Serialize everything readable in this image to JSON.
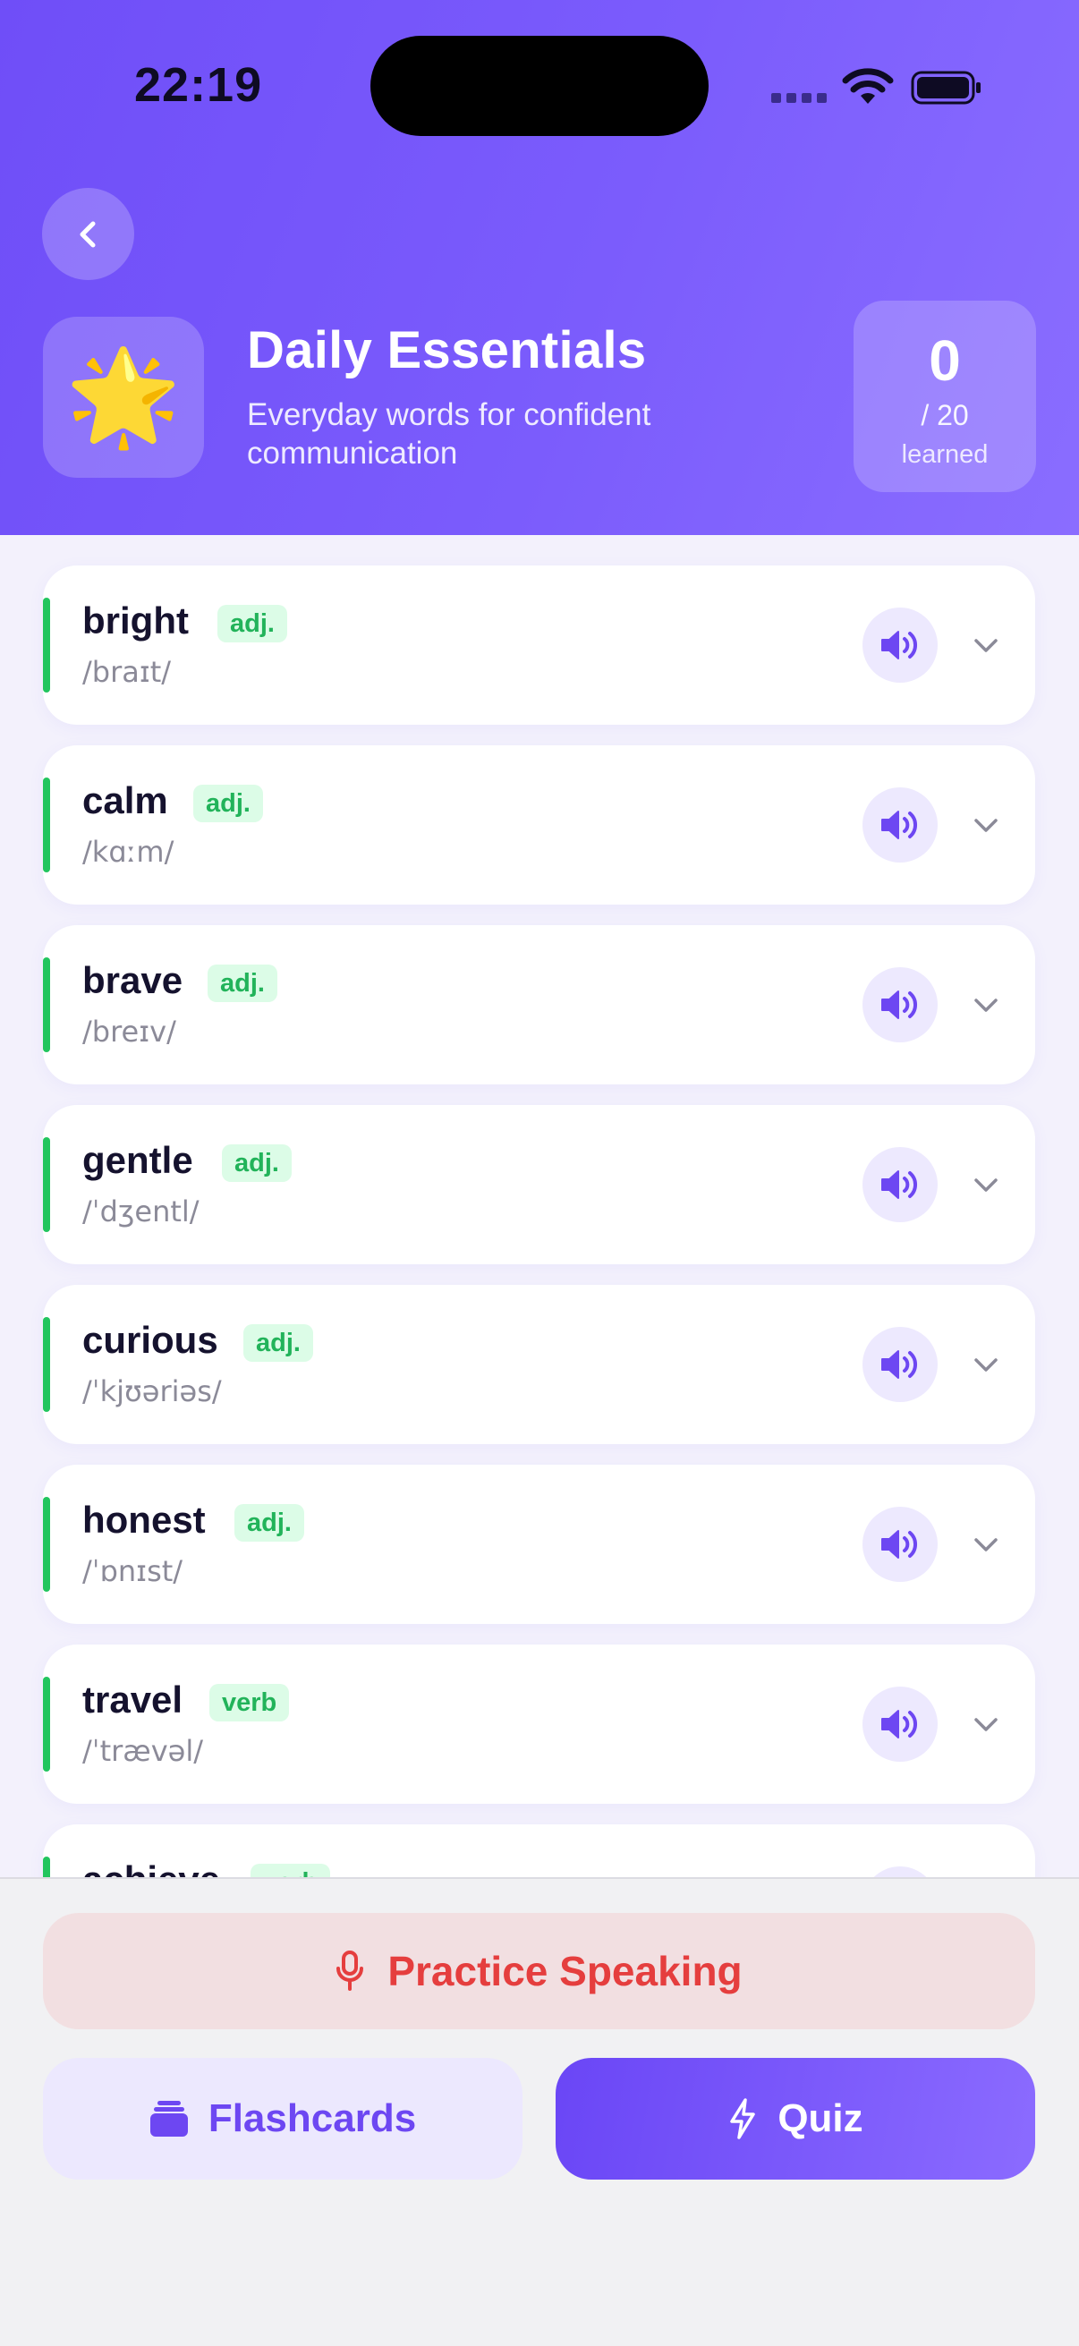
{
  "status_bar": {
    "time": "22:19"
  },
  "header": {
    "deck_emoji": "🌟",
    "title": "Daily Essentials",
    "subtitle": "Everyday words for confident communication",
    "progress": {
      "learned_count": "0",
      "total": "/ 20",
      "label": "learned"
    }
  },
  "colors": {
    "accent": "#7c5cfc",
    "pos_badge": "#22c55e",
    "practice": "#e53e3e"
  },
  "words": [
    {
      "word": "bright",
      "pos": "adj.",
      "phonetic": "/braɪt/"
    },
    {
      "word": "calm",
      "pos": "adj.",
      "phonetic": "/kɑːm/"
    },
    {
      "word": "brave",
      "pos": "adj.",
      "phonetic": "/breɪv/"
    },
    {
      "word": "gentle",
      "pos": "adj.",
      "phonetic": "/ˈdʒentl/"
    },
    {
      "word": "curious",
      "pos": "adj.",
      "phonetic": "/ˈkjʊəriəs/"
    },
    {
      "word": "honest",
      "pos": "adj.",
      "phonetic": "/ˈɒnɪst/"
    },
    {
      "word": "travel",
      "pos": "verb",
      "phonetic": "/ˈtrævəl/"
    },
    {
      "word": "achieve",
      "pos": "verb",
      "phonetic": ""
    }
  ],
  "actions": {
    "practice_label": "Practice Speaking",
    "flashcards_label": "Flashcards",
    "quiz_label": "Quiz"
  }
}
